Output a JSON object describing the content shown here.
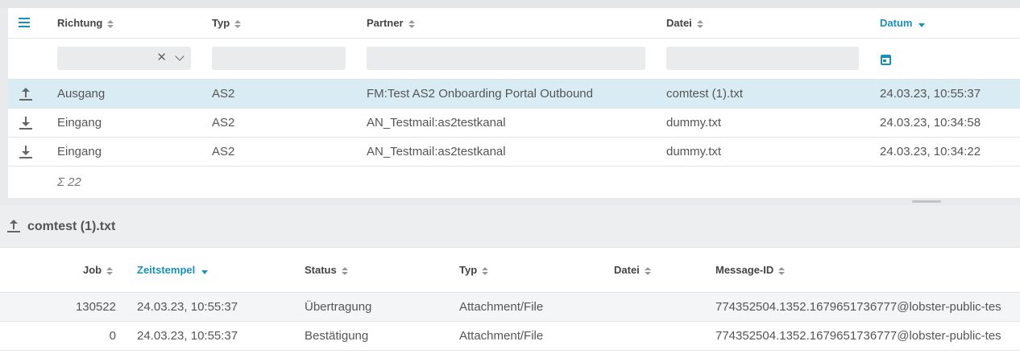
{
  "top_table": {
    "columns": {
      "richtung": "Richtung",
      "typ": "Typ",
      "partner": "Partner",
      "datei": "Datei",
      "datum": "Datum"
    },
    "filter": {
      "richtung_value": "",
      "typ_value": "",
      "partner_value": "",
      "datei_value": ""
    },
    "rows": [
      {
        "direction_icon": "upload-icon",
        "richtung": "Ausgang",
        "typ": "AS2",
        "partner": "FM:Test AS2 Onboarding Portal Outbound",
        "datei": "comtest (1).txt",
        "datum": "24.03.23, 10:55:37",
        "selected": true
      },
      {
        "direction_icon": "download-icon",
        "richtung": "Eingang",
        "typ": "AS2",
        "partner": "AN_Testmail:as2testkanal",
        "datei": "dummy.txt",
        "datum": "24.03.23, 10:34:58",
        "selected": false
      },
      {
        "direction_icon": "download-icon",
        "richtung": "Eingang",
        "typ": "AS2",
        "partner": "AN_Testmail:as2testkanal",
        "datei": "dummy.txt",
        "datum": "24.03.23, 10:34:22",
        "selected": false
      }
    ],
    "sum_label": "Σ 22"
  },
  "detail": {
    "title": "comtest (1).txt",
    "title_icon": "upload-icon",
    "columns": {
      "job": "Job",
      "zeitstempel": "Zeitstempel",
      "status": "Status",
      "typ": "Typ",
      "datei": "Datei",
      "message_id": "Message-ID"
    },
    "rows": [
      {
        "job": "130522",
        "zeitstempel": "24.03.23, 10:55:37",
        "status": "Übertragung",
        "typ": "Attachment/File",
        "datei": "",
        "message_id": "774352504.1352.1679651736777@lobster-public-tes"
      },
      {
        "job": "0",
        "zeitstempel": "24.03.23, 10:55:37",
        "status": "Bestätigung",
        "typ": "Attachment/File",
        "datei": "",
        "message_id": "774352504.1352.1679651736777@lobster-public-tes"
      }
    ]
  },
  "colors": {
    "accent": "#1891b8",
    "selected_row": "#d9ecf3",
    "text": "#555555"
  }
}
